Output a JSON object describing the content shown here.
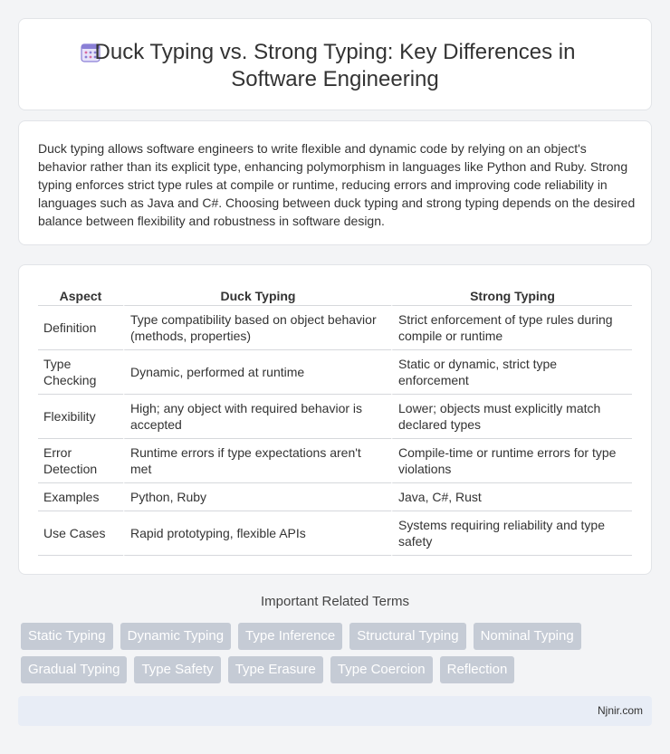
{
  "title": {
    "icon": "calendar-grid-icon",
    "line1": "Duck Typing vs. Strong Typing: Key Differences in",
    "line2": "Software Engineering"
  },
  "intro": "Duck typing allows software engineers to write flexible and dynamic code by relying on an object's behavior rather than its explicit type, enhancing polymorphism in languages like Python and Ruby. Strong typing enforces strict type rules at compile or runtime, reducing errors and improving code reliability in languages such as Java and C#. Choosing between duck typing and strong typing depends on the desired balance between flexibility and robustness in software design.",
  "table": {
    "headers": [
      "Aspect",
      "Duck Typing",
      "Strong Typing"
    ],
    "rows": [
      [
        "Definition",
        "Type compatibility based on object behavior (methods, properties)",
        "Strict enforcement of type rules during compile or runtime"
      ],
      [
        "Type Checking",
        "Dynamic, performed at runtime",
        "Static or dynamic, strict type enforcement"
      ],
      [
        "Flexibility",
        "High; any object with required behavior is accepted",
        "Lower; objects must explicitly match declared types"
      ],
      [
        "Error Detection",
        "Runtime errors if type expectations aren't met",
        "Compile-time or runtime errors for type violations"
      ],
      [
        "Examples",
        "Python, Ruby",
        "Java, C#, Rust"
      ],
      [
        "Use Cases",
        "Rapid prototyping, flexible APIs",
        "Systems requiring reliability and type safety"
      ]
    ]
  },
  "related": {
    "title": "Important Related Terms",
    "row1": [
      "Static Typing",
      "Dynamic Typing",
      "Type Inference",
      "Structural Typing",
      "Nominal Typing"
    ],
    "row2": [
      "Gradual Typing",
      "Type Safety",
      "Type Erasure",
      "Type Coercion",
      "Reflection"
    ]
  },
  "footer": "Njnir.com",
  "colors": {
    "tag_bg": "#c5cbd5",
    "footer_bg": "#e8edf6",
    "icon_accent": "#8a7fd6"
  }
}
